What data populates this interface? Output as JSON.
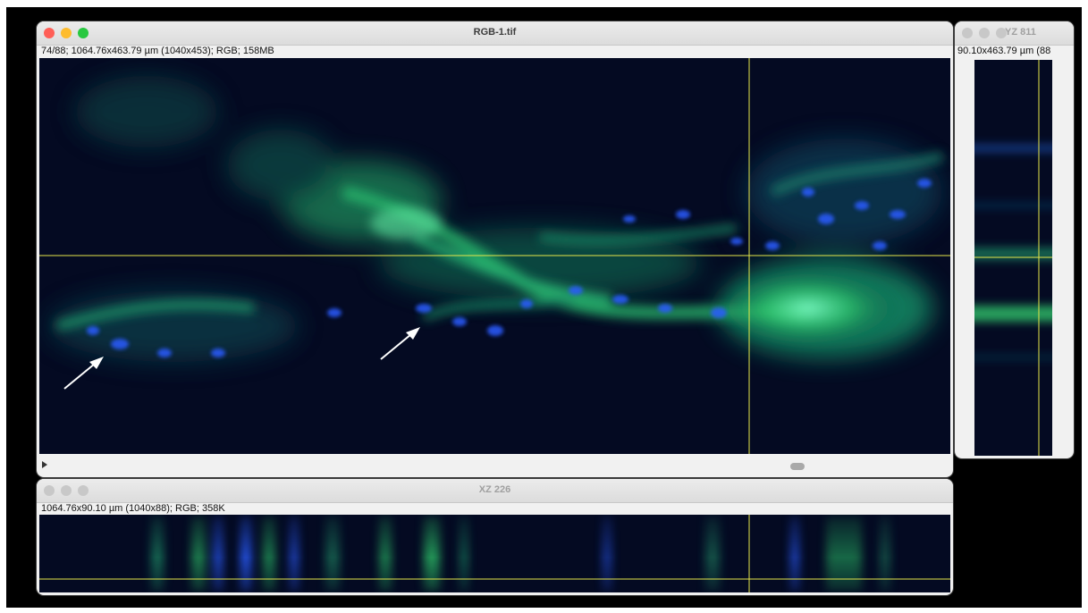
{
  "main_window": {
    "title": "RGB-1.tif",
    "info": "74/88; 1064.76x463.79 µm (1040x453); RGB; 158MB"
  },
  "yz_window": {
    "title": "YZ 811",
    "info": "90.10x463.79 µm (88"
  },
  "xz_window": {
    "title": "XZ 226",
    "info": "1064.76x90.10 µm (1040x88); RGB; 358K"
  },
  "colors": {
    "close": "#ff5f57",
    "minimize": "#febc2e",
    "zoom": "#28c840",
    "inactive_light": "#c8c8c8",
    "crosshair": "#e6e64a",
    "image_background": "#040a22",
    "green_channel": "#2ec46a",
    "blue_channel": "#2a5cff",
    "arrow": "#ffffff"
  },
  "icons": [
    "play-icon",
    "arrow-annotation-icon"
  ]
}
